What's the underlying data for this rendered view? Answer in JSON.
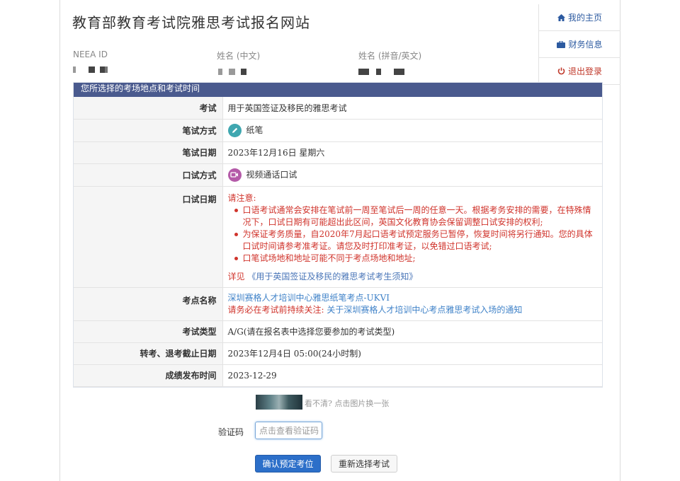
{
  "header": {
    "site_title": "教育部教育考试院雅思考试报名网站"
  },
  "nav": {
    "home": "我的主页",
    "finance": "财务信息",
    "logout": "退出登录",
    "accent": "#2c5aa0",
    "logout_color": "#c0392b"
  },
  "user": {
    "neea_id_label": "NEEA ID",
    "name_cn_label": "姓名 (中文)",
    "name_en_label": "姓名 (拼音/英文)"
  },
  "panel": {
    "title": "您所选择的考场地点和考试时间",
    "rows": {
      "exam": {
        "k": "考试",
        "v": "用于英国签证及移民的雅思考试"
      },
      "written_mode": {
        "k": "笔试方式",
        "v": "纸笔"
      },
      "written_date": {
        "k": "笔试日期",
        "v": "2023年12月16日 星期六"
      },
      "speaking_mode": {
        "k": "口试方式",
        "v": "视频通话口试"
      },
      "speaking_date": {
        "k": "口试日期",
        "notice_title": "请注意:",
        "items": [
          "口语考试通常会安排在笔试前一周至笔试后一周的任意一天。根据考务安排的需要，在特殊情况下，口试日期有可能超出此区间，英国文化教育协会保留调整口试安排的权利;",
          "为保证考务质量，自2020年7月起口语考试预定服务已暂停，恢复时间将另行通知。您的具体口试时间请参考准考证。请您及时打印准考证，以免错过口语考试;",
          "口笔试场地和地址可能不同于考点场地和地址;"
        ],
        "more_prefix": "详见",
        "more_link": "《用于英国签证及移民的雅思考试考生须知》"
      },
      "venue": {
        "k": "考点名称",
        "name": "深圳赛格人才培训中心雅思纸笔考点-UKVI",
        "warn_prefix": "请务必在考试前持续关注:",
        "warn_link": "关于深圳赛格人才培训中心考点雅思考试入场的通知"
      },
      "exam_type": {
        "k": "考试类型",
        "v": "A/G(请在报名表中选择您要参加的考试类型)"
      },
      "deadline": {
        "k": "转考、退考截止日期",
        "v": "2023年12月4日 05:00(24小时制)"
      },
      "result_date": {
        "k": "成绩发布时间",
        "v": "2023-12-29"
      }
    }
  },
  "captcha": {
    "hint": "看不清? 点击图片换一张",
    "label": "验证码",
    "placeholder": "点击查看验证码"
  },
  "actions": {
    "confirm": "确认预定考位",
    "reselect": "重新选择考试"
  }
}
